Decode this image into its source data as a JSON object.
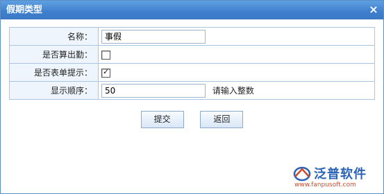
{
  "dialog": {
    "title": "假期类型",
    "close_glyph": "×"
  },
  "form": {
    "name_label": "名称：",
    "name_value": "事假",
    "attendance_label": "是否算出勤：",
    "attendance_checked": false,
    "show_in_form_label": "是否表单提示：",
    "show_in_form_checked": true,
    "order_label": "显示顺序：",
    "order_value": "50",
    "order_hint": "请输入整数"
  },
  "buttons": {
    "submit_label": "提交",
    "back_label": "返回"
  },
  "brand": {
    "name": "泛普软件",
    "url": "www.fanpusoft.com",
    "colors": {
      "primary": "#2a63b5",
      "accent": "#d04a2a",
      "title_bar": "#3e7fcd"
    }
  }
}
